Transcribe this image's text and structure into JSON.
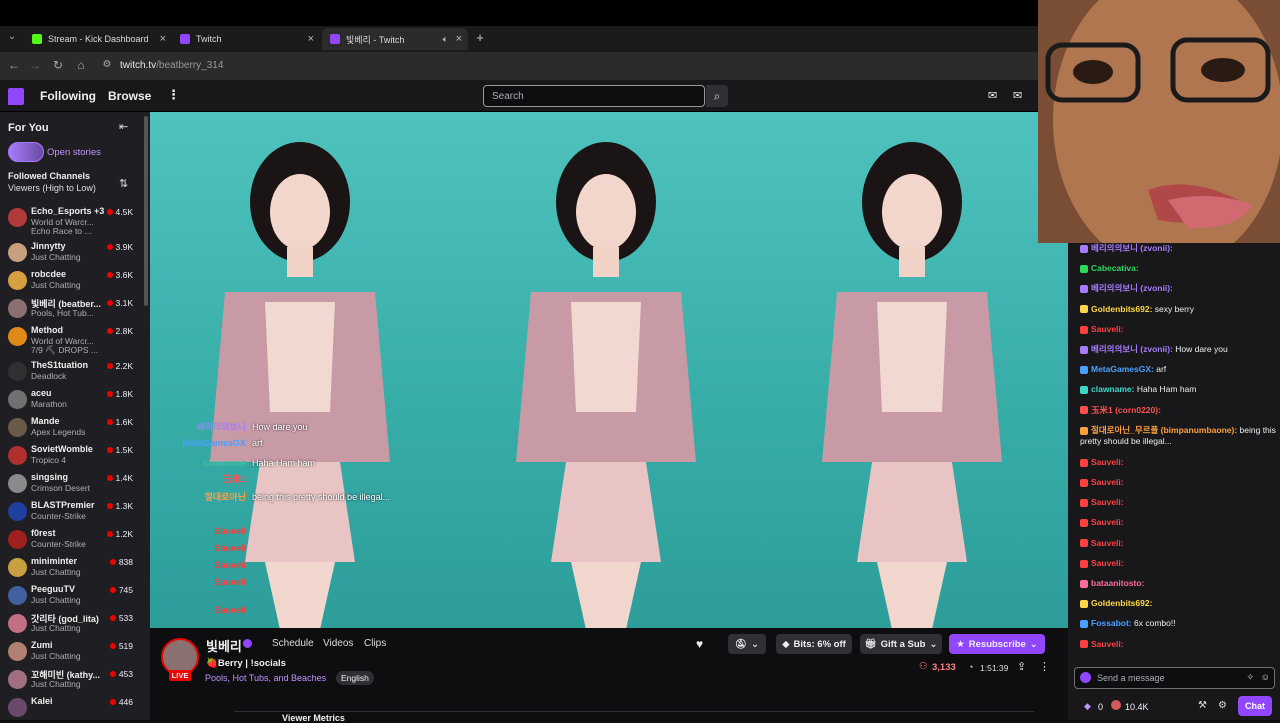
{
  "browser": {
    "tabs": [
      {
        "title": "Stream - Kick Dashboard",
        "favicon": "kick-icon",
        "color": "#53fc18"
      },
      {
        "title": "Twitch",
        "favicon": "twitch-icon",
        "color": "#9147ff"
      },
      {
        "title": "빛베리 - Twitch",
        "favicon": "twitch-icon",
        "color": "#9147ff"
      }
    ],
    "url_host": "twitch.tv",
    "url_path": "/beatberry_314"
  },
  "nav": {
    "following": "Following",
    "browse": "Browse",
    "search_placeholder": "Search"
  },
  "sidebar": {
    "title": "For You",
    "stories": "Open stories",
    "followed_title": "Followed Channels",
    "followed_sort": "Viewers (High to Low)",
    "channels": [
      {
        "name": "Echo_Esports +3",
        "category": "World of Warcr...",
        "extra": "Echo Race to ...",
        "viewers": "4.5K",
        "color": "#b23a3a"
      },
      {
        "name": "Jinnytty",
        "category": "Just Chatting",
        "viewers": "3.9K",
        "color": "#c8a080"
      },
      {
        "name": "robcdee",
        "category": "Just Chatting",
        "viewers": "3.6K",
        "color": "#d6a040"
      },
      {
        "name": "빛베리 (beatber...",
        "category": "Pools, Hot Tub...",
        "viewers": "3.1K",
        "color": "#8a7070"
      },
      {
        "name": "Method",
        "category": "World of Warcr...",
        "extra": "7/9 ⛏ DROPS ...",
        "viewers": "2.8K",
        "color": "#e08a1a"
      },
      {
        "name": "TheS1tuation",
        "category": "Deadlock",
        "viewers": "2.2K",
        "color": "#303030"
      },
      {
        "name": "aceu",
        "category": "Marathon",
        "viewers": "1.8K",
        "color": "#707070"
      },
      {
        "name": "Mande",
        "category": "Apex Legends",
        "viewers": "1.6K",
        "color": "#6a5a4a"
      },
      {
        "name": "SovietWomble",
        "category": "Tropico 4",
        "viewers": "1.5K",
        "color": "#b03030"
      },
      {
        "name": "singsing",
        "category": "Crimson Desert",
        "viewers": "1.4K",
        "color": "#8a8a8a"
      },
      {
        "name": "BLASTPremier",
        "category": "Counter-Strike",
        "viewers": "1.3K",
        "color": "#2040a0"
      },
      {
        "name": "f0rest",
        "category": "Counter-Strike",
        "viewers": "1.2K",
        "color": "#a02020"
      },
      {
        "name": "miniminter",
        "category": "Just Chatting",
        "viewers": "838",
        "color": "#c8a040"
      },
      {
        "name": "PeeguuTV",
        "category": "Just Chatting",
        "viewers": "745",
        "color": "#4060a0"
      },
      {
        "name": "갓리타 (god_lita)",
        "category": "Just Chatting",
        "viewers": "533",
        "color": "#c07080"
      },
      {
        "name": "Zumi",
        "category": "Just Chatting",
        "viewers": "519",
        "color": "#b08070"
      },
      {
        "name": "꼬해미빈 (kathy...",
        "category": "Just Chatting",
        "viewers": "453",
        "color": "#a07080"
      },
      {
        "name": "Kalei",
        "category": "",
        "viewers": "446",
        "color": "#6a4a6a"
      }
    ]
  },
  "overlay_chat": [
    {
      "user": "베리의의보니",
      "text": "How dare you",
      "color": "#a67cff"
    },
    {
      "user": "MetaGamesGX",
      "text": "arf",
      "color": "#4aa0ff"
    },
    {
      "user": "clawname",
      "text": "Haha Ham ham",
      "color": "#3fbfa0"
    },
    {
      "user": "玉米1",
      "text": "",
      "color": "#ff5050"
    },
    {
      "user": "절대로아닌",
      "text": "being this pretty should be illegal...",
      "color": "#ffa040"
    },
    {
      "user": "Sauveli",
      "text": "",
      "color": "#ff3a3a"
    },
    {
      "user": "Sauveli",
      "text": "",
      "color": "#ff3a3a"
    },
    {
      "user": "Sauveli",
      "text": "",
      "color": "#ff3a3a"
    },
    {
      "user": "Sauveli",
      "text": "",
      "color": "#ff3a3a"
    },
    {
      "user": "Sauveli",
      "text": "",
      "color": "#ff3a3a"
    }
  ],
  "chat": [
    {
      "user": "베리의의보니 (zvonii):",
      "text": "",
      "color": "#a67cff"
    },
    {
      "user": "Cabecativa:",
      "text": "",
      "color": "#2fd85a"
    },
    {
      "user": "베리의의보니 (zvonii):",
      "text": "",
      "color": "#a67cff"
    },
    {
      "user": "Goldenbits692:",
      "text": "sexy berry",
      "color": "#ffd84a"
    },
    {
      "user": "Sauveli:",
      "text": "",
      "color": "#ff4040"
    },
    {
      "user": "베리의의보니 (zvonii):",
      "text": "How dare you",
      "color": "#a67cff"
    },
    {
      "user": "MetaGamesGX:",
      "text": "arf",
      "color": "#4aa0ff"
    },
    {
      "user": "clawname:",
      "text": "Haha Ham ham",
      "color": "#3fd8c8"
    },
    {
      "user": "玉米1 (corn0220):",
      "text": "",
      "color": "#ff5050"
    },
    {
      "user": "절대로아닌_무르플 (bimpanumbaone):",
      "text": "being this pretty should be illegal...",
      "color": "#ffa040"
    },
    {
      "user": "Sauveli:",
      "text": "",
      "color": "#ff4040"
    },
    {
      "user": "Sauveli:",
      "text": "",
      "color": "#ff4040"
    },
    {
      "user": "Sauveli:",
      "text": "",
      "color": "#ff4040"
    },
    {
      "user": "Sauveli:",
      "text": "",
      "color": "#ff4040"
    },
    {
      "user": "Sauveli:",
      "text": "",
      "color": "#ff4040"
    },
    {
      "user": "Sauveli:",
      "text": "",
      "color": "#ff4040"
    },
    {
      "user": "bataanitosto:",
      "text": "",
      "color": "#ff6aa0"
    },
    {
      "user": "Goldenbits692:",
      "text": "",
      "color": "#ffd84a"
    },
    {
      "user": "Fossabot:",
      "text": "6x   combo!!",
      "color": "#4aa0ff"
    },
    {
      "user": "Sauveli:",
      "text": "",
      "color": "#ff4040"
    }
  ],
  "chat_input": {
    "placeholder": "Send a message",
    "points": "0",
    "bits": "10.4K",
    "button": "Chat"
  },
  "channel": {
    "name": "빛베리",
    "links": [
      "Schedule",
      "Videos",
      "Clips"
    ],
    "title": "🍓Berry | !socials",
    "category": "Pools, Hot Tubs, and Beaches",
    "language": "English",
    "live": "LIVE",
    "viewers": "3,133",
    "uptime": "1:51:39",
    "bits": "Bits: 6% off",
    "gift": "Gift a Sub",
    "resub": "Resubscribe",
    "metrics": "Viewer Metrics"
  }
}
